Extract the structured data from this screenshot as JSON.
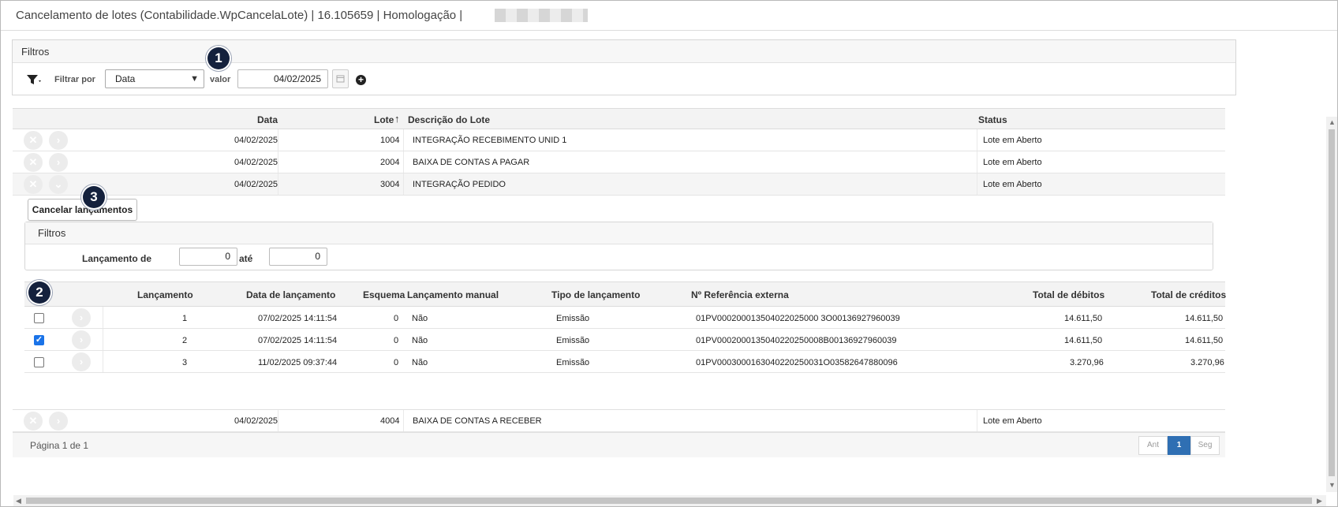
{
  "window": {
    "title": "Cancelamento de lotes (Contabilidade.WpCancelaLote) | 16.105659 | Homologação |"
  },
  "filters": {
    "heading": "Filtros",
    "filter_by_label": "Filtrar por",
    "filter_field_value": "Data",
    "value_label": "valor",
    "value_input": "04/02/2025"
  },
  "badges": {
    "one": "1",
    "two": "2",
    "three": "3"
  },
  "lots_grid": {
    "headers": {
      "data": "Data",
      "lote": "Lote",
      "sort_arrow": "↑",
      "descricao": "Descrição do Lote",
      "status": "Status"
    },
    "rows": [
      {
        "data": "04/02/2025",
        "lote": "1004",
        "descricao": "INTEGRAÇÃO RECEBIMENTO UNID 1",
        "status": "Lote em Aberto"
      },
      {
        "data": "04/02/2025",
        "lote": "2004",
        "descricao": "BAIXA DE CONTAS A PAGAR",
        "status": "Lote em Aberto"
      },
      {
        "data": "04/02/2025",
        "lote": "3004",
        "descricao": "INTEGRAÇÃO PEDIDO",
        "status": "Lote em Aberto"
      },
      {
        "data": "04/02/2025",
        "lote": "4004",
        "descricao": "BAIXA DE CONTAS A RECEBER",
        "status": "Lote em Aberto"
      }
    ]
  },
  "detail": {
    "cancel_button": "Cancelar lançamentos",
    "filters_heading": "Filtros",
    "from_label": "Lançamento de",
    "from_value": "0",
    "to_label": "até",
    "to_value": "0",
    "headers": {
      "lancamento": "Lançamento",
      "data": "Data de lançamento",
      "esquema": "Esquema",
      "manual": "Lançamento manual",
      "tipo": "Tipo de lançamento",
      "referencia": "Nº Referência externa",
      "debitos": "Total de débitos",
      "creditos": "Total de créditos"
    },
    "rows": [
      {
        "checked": false,
        "lancamento": "1",
        "data": "07/02/2025 14:11:54",
        "esquema": "0",
        "manual": "Não",
        "tipo": "Emissão",
        "referencia": "01PV000200013504022025000 3O00136927960039",
        "debitos": "14.611,50",
        "creditos": "14.611,50"
      },
      {
        "checked": true,
        "lancamento": "2",
        "data": "07/02/2025 14:11:54",
        "esquema": "0",
        "manual": "Não",
        "tipo": "Emissão",
        "referencia": "01PV0002000135040220250008B00136927960039",
        "debitos": "14.611,50",
        "creditos": "14.611,50"
      },
      {
        "checked": false,
        "lancamento": "3",
        "data": "11/02/2025 09:37:44",
        "esquema": "0",
        "manual": "Não",
        "tipo": "Emissão",
        "referencia": "01PV0003000163040220250031O03582647880096",
        "debitos": "3.270,96",
        "creditos": "3.270,96"
      }
    ]
  },
  "footer": {
    "page_info": "Página 1 de 1",
    "prev": "Ant",
    "current": "1",
    "next": "Seg"
  },
  "colors": {
    "badge": "#14213d",
    "pager_active": "#2f6fb3",
    "checkbox_on": "#1a73e8"
  }
}
